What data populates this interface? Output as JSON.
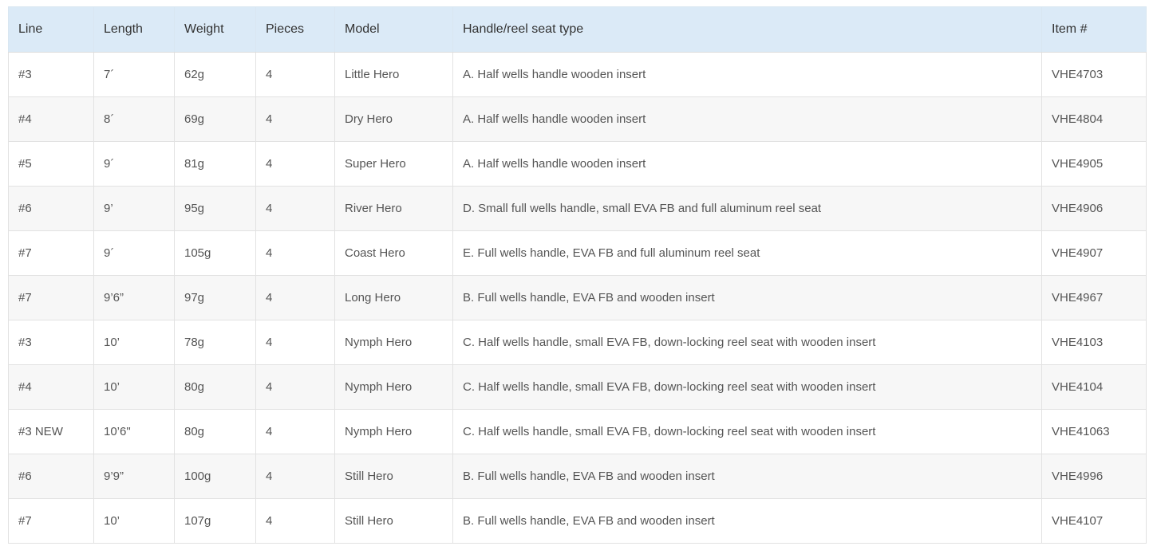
{
  "table": {
    "headers": [
      "Line",
      "Length",
      "Weight",
      "Pieces",
      "Model",
      "Handle/reel seat type",
      "Item #"
    ],
    "rows": [
      [
        "#3",
        "7´",
        "62g",
        "4",
        "Little Hero",
        "A. Half wells handle wooden insert",
        "VHE4703"
      ],
      [
        "#4",
        "8´",
        "69g",
        "4",
        "Dry Hero",
        "A. Half wells handle wooden insert",
        "VHE4804"
      ],
      [
        "#5",
        "9´",
        "81g",
        "4",
        "Super Hero",
        "A. Half wells handle wooden insert",
        "VHE4905"
      ],
      [
        "#6",
        "9’",
        "95g",
        "4",
        "River Hero",
        "D. Small full wells handle, small EVA FB and full aluminum reel seat",
        "VHE4906"
      ],
      [
        "#7",
        "9´",
        "105g",
        "4",
        "Coast Hero",
        "E. Full wells handle, EVA FB and full aluminum reel seat",
        "VHE4907"
      ],
      [
        "#7",
        "9’6”",
        "97g",
        "4",
        "Long Hero",
        "B. Full wells handle, EVA FB and wooden insert",
        "VHE4967"
      ],
      [
        "#3",
        "10’",
        "78g",
        "4",
        "Nymph Hero",
        "C. Half wells handle, small EVA FB, down-locking reel seat with wooden insert",
        "VHE4103"
      ],
      [
        "#4",
        "10’",
        "80g",
        "4",
        "Nymph Hero",
        "C. Half wells handle, small EVA FB, down-locking reel seat with wooden insert",
        "VHE4104"
      ],
      [
        "#3 NEW",
        "10’6\"",
        "80g",
        "4",
        "Nymph Hero",
        "C. Half wells handle, small EVA FB, down-locking reel seat with wooden insert",
        "VHE41063"
      ],
      [
        "#6",
        "9’9”",
        "100g",
        "4",
        "Still Hero",
        "B. Full wells handle, EVA FB and wooden insert",
        "VHE4996"
      ],
      [
        "#7",
        "10’",
        "107g",
        "4",
        "Still Hero",
        "B. Full wells handle, EVA FB and wooden insert",
        "VHE4107"
      ]
    ]
  },
  "colors": {
    "header_bg": "#dbeaf7",
    "row_alt_bg": "#f7f7f7",
    "border": "#e2e2e2",
    "text": "#555555"
  }
}
